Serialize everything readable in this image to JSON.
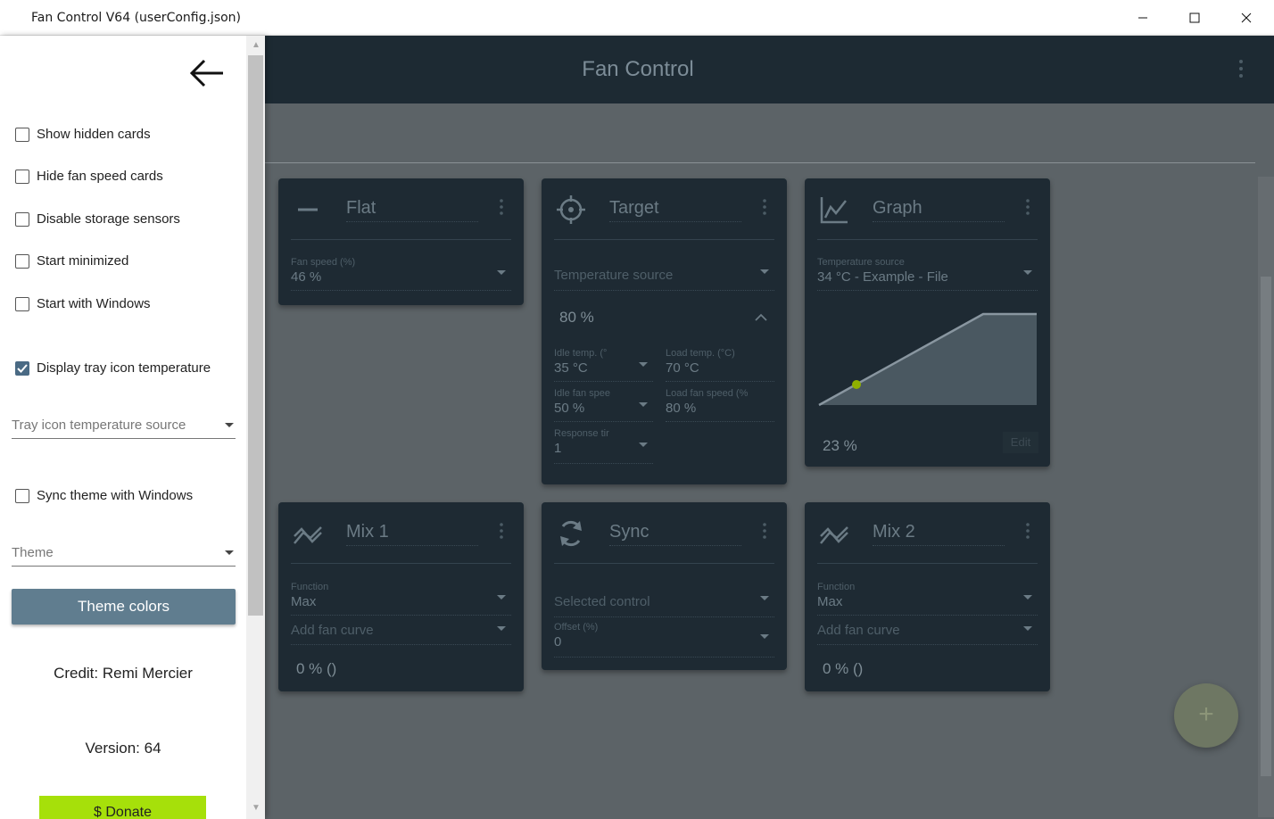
{
  "window": {
    "title": "Fan Control V64 (userConfig.json)"
  },
  "appbar": {
    "title": "Fan Control"
  },
  "drawer": {
    "checkboxes": [
      {
        "label": "Show hidden cards",
        "checked": false
      },
      {
        "label": "Hide fan speed cards",
        "checked": false
      },
      {
        "label": "Disable storage sensors",
        "checked": false
      },
      {
        "label": "Start minimized",
        "checked": false
      },
      {
        "label": "Start with Windows",
        "checked": false
      },
      {
        "label": "Display tray icon temperature",
        "checked": true
      },
      {
        "label": "Sync theme with Windows",
        "checked": false
      }
    ],
    "tray_source_placeholder": "Tray icon temperature source",
    "theme_placeholder": "Theme",
    "theme_colors_label": "Theme colors",
    "credit": "Credit: Remi Mercier",
    "version": "Version: 64",
    "donate_label": "$  Donate"
  },
  "cards": {
    "flat": {
      "name": "Flat",
      "fan_speed_label": "Fan speed (%)",
      "fan_speed_value": "46 %"
    },
    "target": {
      "name": "Target",
      "temp_source_placeholder": "Temperature source",
      "value": "80 %",
      "idle_temp_label": "Idle temp. (°",
      "idle_temp_value": "35 °C",
      "load_temp_label": "Load temp. (°C)",
      "load_temp_value": "70 °C",
      "idle_fan_label": "Idle fan spee",
      "idle_fan_value": "50 %",
      "load_fan_label": "Load fan speed (%",
      "load_fan_value": "80 %",
      "response_label": "Response tir",
      "response_value": "1"
    },
    "graph": {
      "name": "Graph",
      "temp_source_label": "Temperature source",
      "temp_source_value": "34 °C - Example - File",
      "value": "23 %",
      "edit_label": "Edit"
    },
    "mix1": {
      "name": "Mix 1",
      "function_label": "Function",
      "function_value": "Max",
      "add_curve_placeholder": "Add fan curve",
      "value": "0 % ()"
    },
    "sync": {
      "name": "Sync",
      "selected_control_placeholder": "Selected control",
      "offset_label": "Offset (%)",
      "offset_value": "0"
    },
    "mix2": {
      "name": "Mix 2",
      "function_label": "Function",
      "function_value": "Max",
      "add_curve_placeholder": "Add fan curve",
      "value": "0 % ()"
    }
  },
  "fab": {
    "label": "+"
  },
  "colors": {
    "appbar": "#1d2a33",
    "card": "#1e2a33",
    "overlay": "#5c6367",
    "theme_button": "#607d8f",
    "donate": "#a6e00a",
    "graph_point": "#8fb000"
  }
}
